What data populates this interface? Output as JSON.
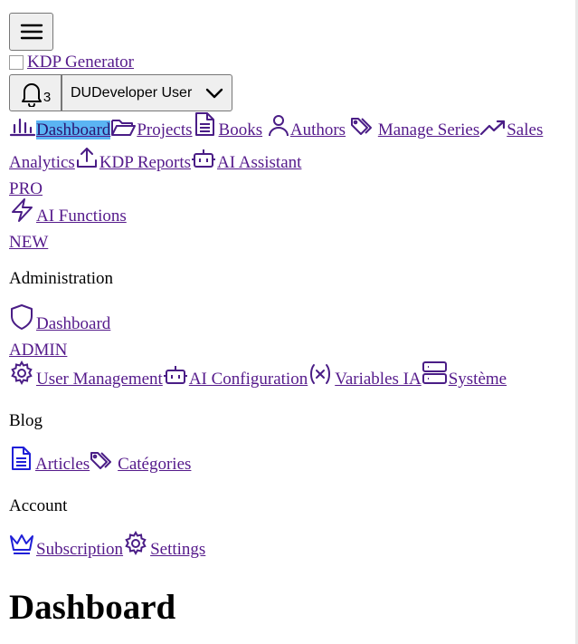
{
  "header": {
    "menu_icon": "menu-icon",
    "logo_alt": "KDP Generator",
    "notifications_count": "3",
    "user_initials": "DU",
    "user_name": "Developer User"
  },
  "nav": {
    "dashboard": "Dashboard",
    "projects": "Projects",
    "books": "Books",
    "authors": "Authors",
    "manage_series": "Manage Series",
    "sales_analytics": "Sales Analytics",
    "kdp_reports": "KDP Reports",
    "ai_assistant": "AI Assistant",
    "ai_assistant_badge": "PRO",
    "ai_functions": "AI Functions",
    "ai_functions_badge": "NEW"
  },
  "admin": {
    "title": "Administration",
    "dashboard": "Dashboard",
    "dashboard_badge": "ADMIN",
    "user_management": "User Management",
    "ai_configuration": "AI Configuration",
    "variables_ia": "Variables IA",
    "systeme": "Système"
  },
  "blog": {
    "title": "Blog",
    "articles": "Articles",
    "categories": "Catégories"
  },
  "account": {
    "title": "Account",
    "subscription": "Subscription",
    "settings": "Settings"
  },
  "main": {
    "page_title": "Dashboard"
  },
  "colors": {
    "link": "#551a8b",
    "active_highlight": "#5bb4f3",
    "icon_purple": "#4a1d86",
    "icon_blue": "#1f1fd8"
  }
}
